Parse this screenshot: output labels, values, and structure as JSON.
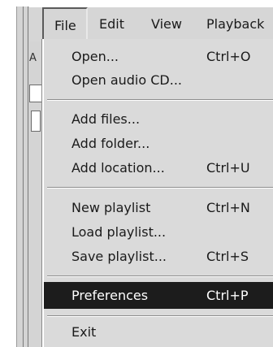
{
  "menubar": {
    "items": [
      {
        "label": "File"
      },
      {
        "label": "Edit"
      },
      {
        "label": "View"
      },
      {
        "label": "Playback"
      }
    ]
  },
  "background": {
    "tab_fragment": "A"
  },
  "file_menu": {
    "items": [
      {
        "label": "Open...",
        "shortcut": "Ctrl+O"
      },
      {
        "label": "Open audio CD...",
        "shortcut": ""
      },
      {
        "label": "Add files...",
        "shortcut": ""
      },
      {
        "label": "Add folder...",
        "shortcut": ""
      },
      {
        "label": "Add location...",
        "shortcut": "Ctrl+U"
      },
      {
        "label": "New playlist",
        "shortcut": "Ctrl+N"
      },
      {
        "label": "Load playlist...",
        "shortcut": ""
      },
      {
        "label": "Save playlist...",
        "shortcut": "Ctrl+S"
      },
      {
        "label": "Preferences",
        "shortcut": "Ctrl+P"
      },
      {
        "label": "Exit",
        "shortcut": ""
      }
    ],
    "highlighted": "Preferences",
    "highlight_color": "#1c1c1c"
  }
}
